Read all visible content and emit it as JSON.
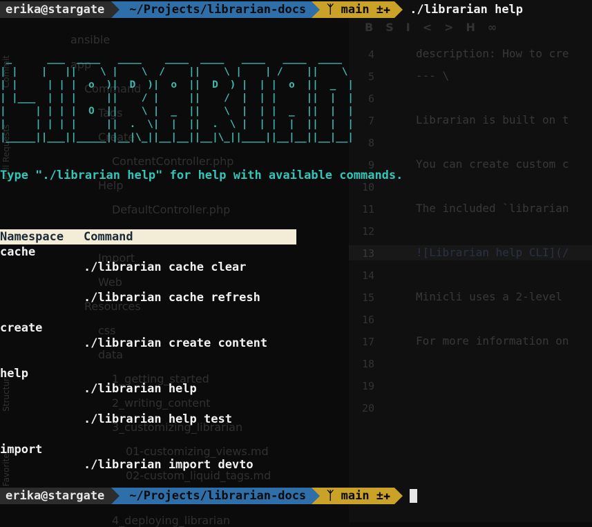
{
  "background_ide": {
    "tree_items": [
      "ansible",
      "app",
      "Command",
      "Tags",
      "Create",
      "ContentController.php",
      "Help",
      "DefaultController.php",
      "Import",
      "Web",
      "Resources",
      "css",
      "data",
      "1_getting_started",
      "2_writing_content",
      "3_customizing_librarian",
      "01-customizing_views.md",
      "02-custom_liquid_tags.md",
      "4_deploying_librarian"
    ],
    "side_tabs": [
      "Commit",
      "Pull Requests",
      "Structure",
      "Favorites"
    ],
    "editor_lines": [
      {
        "num": "4",
        "text": "description: How to cre"
      },
      {
        "num": "5",
        "text": "--- \\"
      },
      {
        "num": "6",
        "text": ""
      },
      {
        "num": "7",
        "text": "Librarian is built on t"
      },
      {
        "num": "8",
        "text": ""
      },
      {
        "num": "9",
        "text": "You can create custom c"
      },
      {
        "num": "10",
        "text": ""
      },
      {
        "num": "11",
        "text": "The included `librarian"
      },
      {
        "num": "12",
        "text": ""
      },
      {
        "num": "13",
        "text": "![Librarian help CLI](/"
      },
      {
        "num": "14",
        "text": ""
      },
      {
        "num": "15",
        "text": "Minicli uses a 2-level"
      },
      {
        "num": "16",
        "text": ""
      },
      {
        "num": "17",
        "text": "For more information on"
      },
      {
        "num": "18",
        "text": ""
      },
      {
        "num": "19",
        "text": ""
      },
      {
        "num": "20",
        "text": ""
      }
    ],
    "toolbar_icons": [
      "bold-icon",
      "strikethrough-icon",
      "italic-icon",
      "code-icon",
      "heading-icon",
      "heading-alt-icon",
      "link-icon"
    ]
  },
  "terminal": {
    "prompt": {
      "user": "erika@stargate",
      "path": "~/Projects/librarian-docs",
      "branch": "main ±✚",
      "command": "./librarian help"
    },
    "banner": " _      ___  ____   ____    ____  ____   ____   ____  ____\n| |    |   ||    \\ |    \\  /    ||    \\ |    | /    ||    \\\n| |     | | |  o  )|  D  )|  o  ||  D  ) |  | |  o  ||  _  |\n| |___  | | |     ||    / |     ||    /  |  | |     ||  |  |\n|     | | | |  O  ||    \\ |  _  ||    \\  |  | |  _  ||  |  |\n|     | | | |     ||  .  \\|  |  ||  .  \\ |  | |  |  ||  |  |\n|_____||___||_____||__|\\_||__|__||__|\\_||____||__|__||__|__|",
    "hint": "Type \"./librarian help\" for help with available commands.",
    "table": {
      "headers": [
        "Namespace",
        "Command"
      ],
      "groups": [
        {
          "namespace": "cache",
          "commands": [
            "./librarian cache clear",
            "./librarian cache refresh"
          ]
        },
        {
          "namespace": "create",
          "commands": [
            "./librarian create content"
          ]
        },
        {
          "namespace": "help",
          "commands": [
            "./librarian help",
            "./librarian help test"
          ]
        },
        {
          "namespace": "import",
          "commands": [
            "./librarian import devto"
          ]
        }
      ]
    },
    "prompt2": {
      "user": "erika@stargate",
      "path": "~/Projects/librarian-docs",
      "branch": "main ±✚"
    }
  },
  "colors": {
    "prompt_user_bg": "#2c2c2c",
    "prompt_path_bg": "#2f6fa9",
    "prompt_git_bg": "#c9a227",
    "banner": "#3fb8b0",
    "table_header_bg": "#f3ecd6"
  }
}
